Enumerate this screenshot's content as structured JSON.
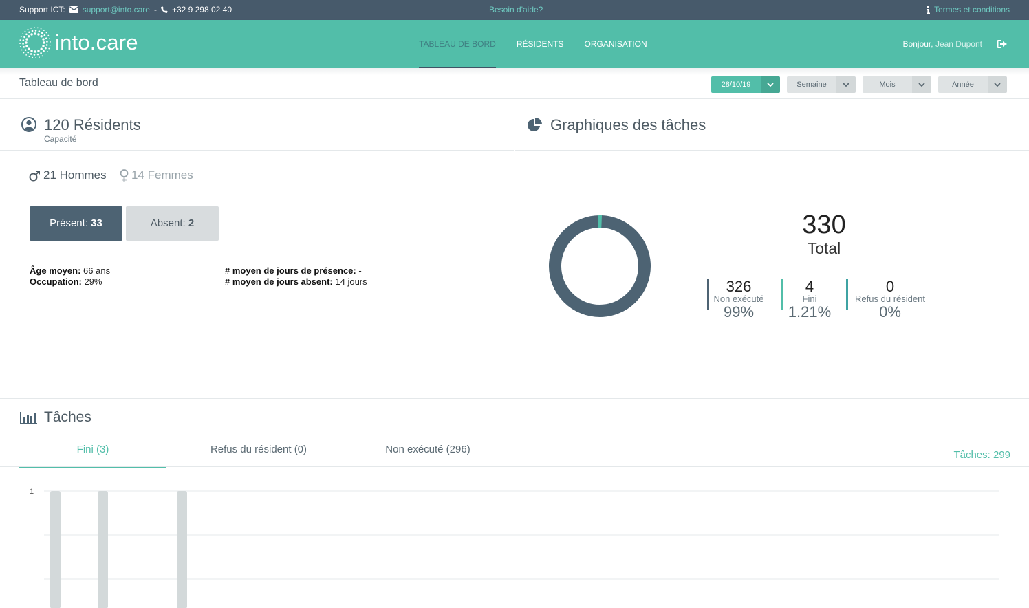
{
  "support": {
    "label": "Support ICT:",
    "email": "support@into.care",
    "separator": "-",
    "phone": "+32 9 298 02 40",
    "help": "Besoin d'aide?",
    "terms": "Termes et conditions"
  },
  "brand": {
    "name": "into.care"
  },
  "nav": {
    "items": [
      {
        "label": "TABLEAU DE BORD",
        "active": true
      },
      {
        "label": "RÉSIDENTS",
        "active": false
      },
      {
        "label": "ORGANISATION",
        "active": false
      }
    ],
    "greeting": "Bonjour,",
    "user": "Jean Dupont"
  },
  "subheader": {
    "title": "Tableau de bord",
    "filters": [
      "28/10/19",
      "Semaine",
      "Mois",
      "Année"
    ]
  },
  "residents": {
    "title": "120 Résidents",
    "subtitle": "Capacité",
    "men": "21 Hommes",
    "women": "14 Femmes",
    "present_label": "Présent:",
    "present_value": "33",
    "absent_label": "Absent:",
    "absent_value": "2",
    "avg_age_label": "Âge moyen:",
    "avg_age_value": "66 ans",
    "occupancy_label": "Occupation:",
    "occupancy_value": "29%",
    "avg_presence_label": "# moyen de jours de présence:",
    "avg_presence_value": "-",
    "avg_absent_label": "# moyen de jours absent:",
    "avg_absent_value": "14 jours"
  },
  "task_charts": {
    "title": "Graphiques des tâches",
    "total": "330",
    "total_label": "Total",
    "stats": [
      {
        "value": "326",
        "label": "Non exécuté",
        "percent": "99%",
        "color": "#4d6373"
      },
      {
        "value": "4",
        "label": "Fini",
        "percent": "1.21%",
        "color": "#52bea9"
      },
      {
        "value": "0",
        "label": "Refus du résident",
        "percent": "0%",
        "color": "#3fa3a3"
      }
    ],
    "donut_fraction_done": 0.0121
  },
  "tasks": {
    "title": "Tâches",
    "tabs": [
      "Fini (3)",
      "Refus du résident (0)",
      "Non exécuté (296)"
    ],
    "count": "Tâches: 299"
  },
  "chart_data": {
    "type": "bar",
    "categories": [
      "",
      "",
      ""
    ],
    "values": [
      1,
      1,
      1
    ],
    "ylim": [
      0,
      1
    ],
    "ytick_labels": [
      "1"
    ],
    "grid": true
  },
  "colors": {
    "accent": "#52bea9",
    "dark": "#4d6373",
    "topbar": "#475a6b"
  }
}
